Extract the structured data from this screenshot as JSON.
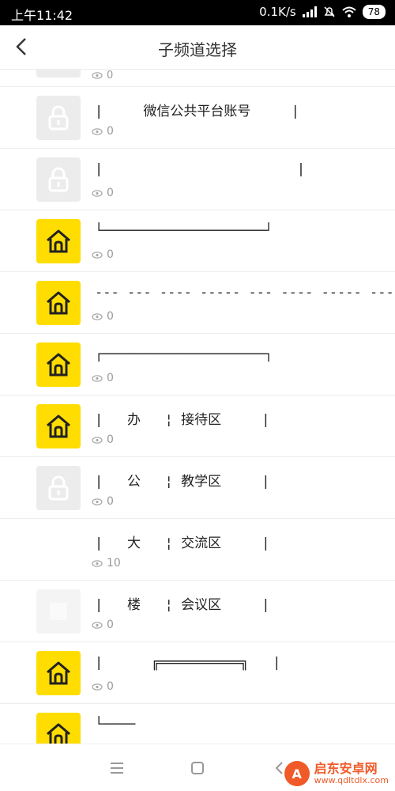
{
  "status_bar": {
    "time": "上午11:42",
    "network_speed": "0.1K/s",
    "battery": "78"
  },
  "header": {
    "title": "子频道选择"
  },
  "list": {
    "partial_top": {
      "views": "0"
    },
    "items": [
      {
        "icon": "lock",
        "title": "|     微信公共平台账号     |",
        "views": "0"
      },
      {
        "icon": "lock",
        "title": "|                        |",
        "views": "0"
      },
      {
        "icon": "house",
        "title": "└────────────────────┘",
        "views": "0"
      },
      {
        "icon": "house",
        "title": "--- --- ---- ----- --- ---- ----- --- ---- ---",
        "views": "0"
      },
      {
        "icon": "house",
        "title": "┌────────────────────┐",
        "views": "0"
      },
      {
        "icon": "house",
        "title": "|   办   ¦ 接待区     |",
        "views": "0"
      },
      {
        "icon": "lock",
        "title": "|   公   ¦ 教学区     |",
        "views": "0"
      },
      {
        "icon": "mosaic",
        "title": "|   大   ¦ 交流区     |",
        "views": "10"
      },
      {
        "icon": "blank",
        "title": "|   楼   ¦ 会议区     |",
        "views": "0"
      },
      {
        "icon": "house",
        "title": "|      ╔══════════╗   |",
        "views": "0"
      },
      {
        "icon": "house",
        "title": "└────",
        "views": ""
      }
    ]
  },
  "watermark": {
    "name": "启东安卓网",
    "url": "www.qdltdlx.com"
  },
  "colors": {
    "accent_yellow": "#ffdd00",
    "lock_gray": "#ececec",
    "watermark_orange": "#f05a28"
  }
}
